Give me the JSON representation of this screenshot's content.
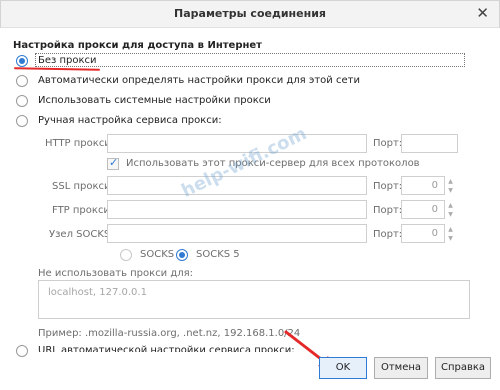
{
  "window": {
    "title": "Параметры соединения",
    "close_glyph": "✕"
  },
  "section_title": "Настройка прокси для доступа в Интернет",
  "proxy_options": [
    {
      "label": "Без прокси",
      "selected": true
    },
    {
      "label": "Автоматически определять настройки прокси для этой сети",
      "selected": false
    },
    {
      "label": "Использовать системные настройки прокси",
      "selected": false
    },
    {
      "label": "Ручная настройка сервиса прокси:",
      "selected": false
    }
  ],
  "manual": {
    "http_label": "HTTP прокси:",
    "port_label": "Порт:",
    "use_for_all_label": "Использовать этот прокси-сервер для всех протоколов",
    "use_for_all_checked": true,
    "ssl_label": "SSL прокси:",
    "ssl_port": "0",
    "ftp_label": "FTP прокси:",
    "ftp_port": "0",
    "socks_label": "Узел SOCKS:",
    "socks_port": "0",
    "socks4_label": "SOCKS 4",
    "socks5_label": "SOCKS 5",
    "socks_selected": "SOCKS 5"
  },
  "no_proxy": {
    "label": "Не использовать прокси для:",
    "placeholder": "localhost, 127.0.0.1",
    "example": "Пример: .mozilla-russia.org, .net.nz, 192.168.1.0/24"
  },
  "auto_config_label": "URL автоматической настройки сервиса прокси:",
  "buttons": {
    "ok": "OK",
    "cancel": "Отмена",
    "help": "Справка"
  },
  "watermark": "help-wifi.com",
  "accent_color": "#2f7bd3",
  "annotation_color": "#e52929"
}
